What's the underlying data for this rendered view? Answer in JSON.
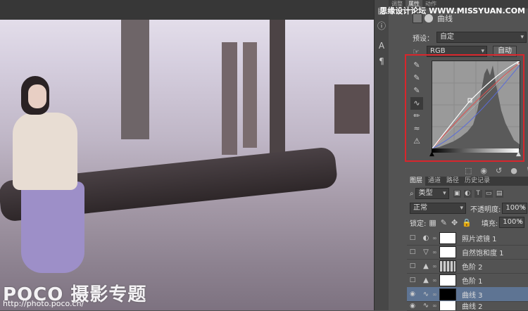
{
  "canvas": {
    "watermark": "POCO 摄影专题",
    "watermark_url": "http://photo.poco.cn/"
  },
  "site_watermark": "思缘设计论坛 WWW.MISSYUAN.COM",
  "panel_tabs": [
    "调整",
    "属性",
    "动作"
  ],
  "properties": {
    "title": "曲线",
    "preset_label": "预设：",
    "preset_value": "自定",
    "channel_value": "RGB",
    "auto_button": "自动"
  },
  "layers_panel": {
    "tabs": [
      "图层",
      "通道",
      "路径",
      "历史记录"
    ],
    "filter_kind": "类型",
    "blend_mode": "正常",
    "opacity_label": "不透明度:",
    "opacity_value": "100%",
    "lock_label": "锁定:",
    "fill_label": "填充:",
    "fill_value": "100%",
    "layers": [
      {
        "name": "照片滤镜 1",
        "mask": "white",
        "visible": false
      },
      {
        "name": "自然饱和度 1",
        "mask": "white",
        "visible": false
      },
      {
        "name": "色阶 2",
        "mask": "grain",
        "visible": false
      },
      {
        "name": "色阶 1",
        "mask": "white",
        "visible": false
      },
      {
        "name": "曲线 3",
        "mask": "dark",
        "visible": true,
        "selected": true
      },
      {
        "name": "曲线 2",
        "mask": "white",
        "visible": true
      }
    ]
  },
  "colors": {
    "highlight_box": "#d8262c",
    "selected_layer": "#5e7493",
    "curve_rgb": "#ffffff",
    "curve_red": "#e05050",
    "curve_blue": "#5b6cd8"
  }
}
